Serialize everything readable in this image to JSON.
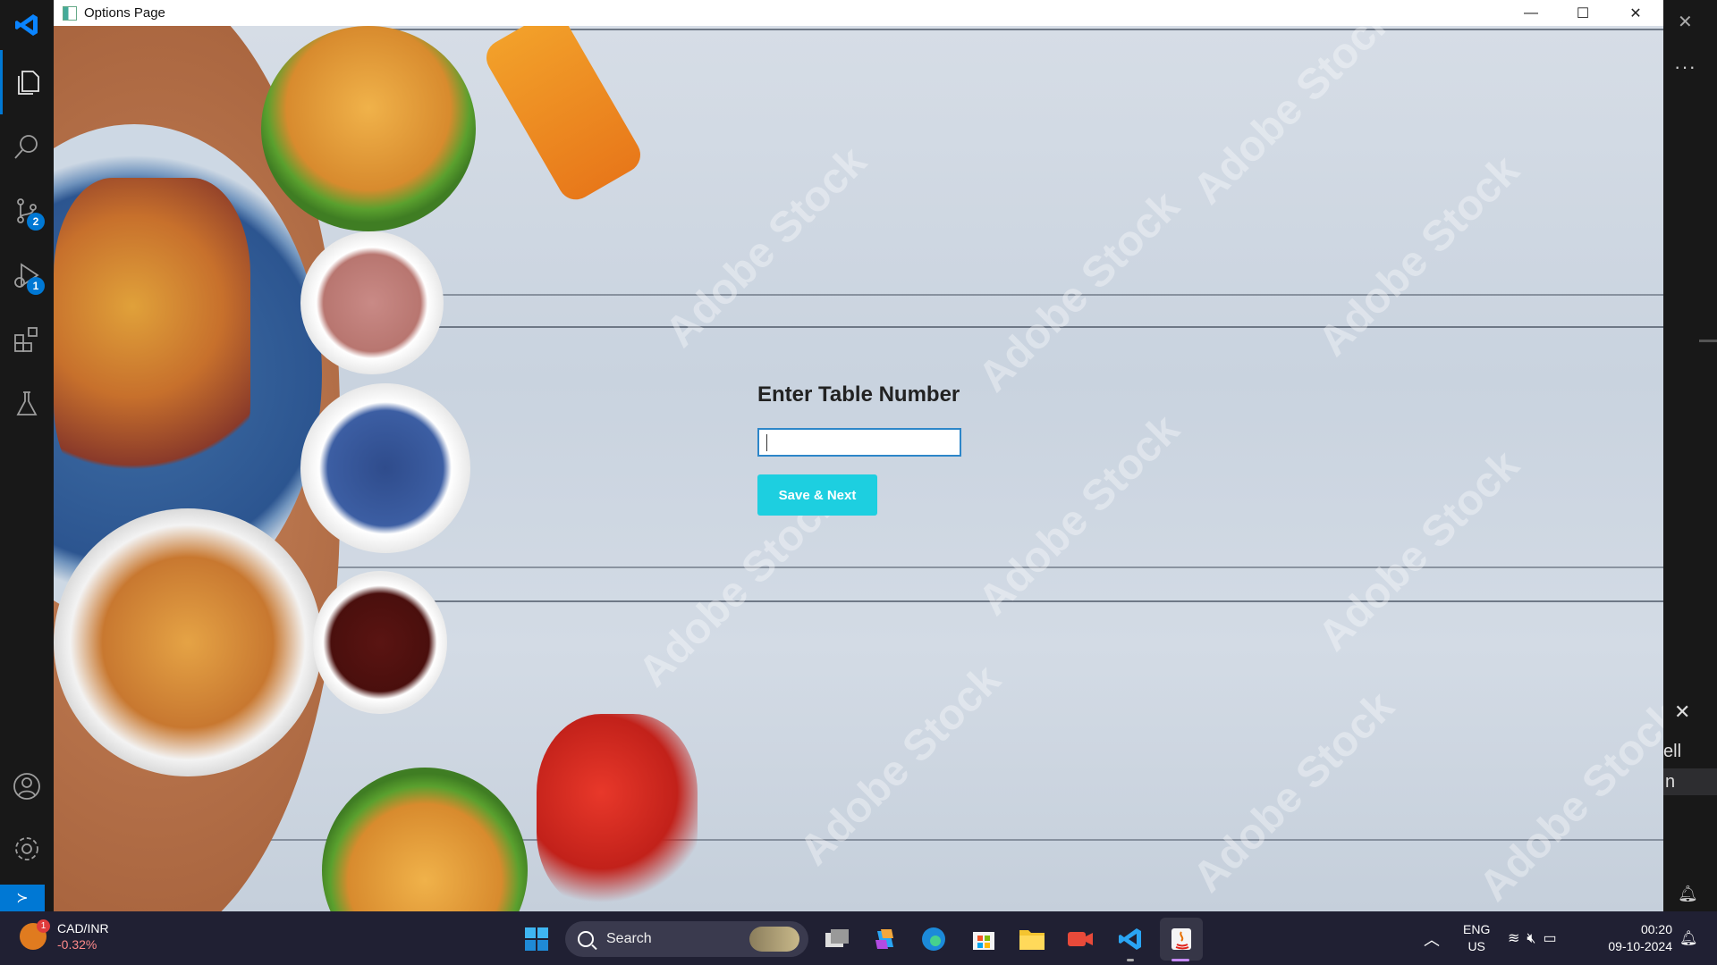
{
  "window": {
    "title": "Options Page",
    "minimize_glyph": "—",
    "maximize_glyph": "☐",
    "close_glyph": "✕"
  },
  "form": {
    "heading": "Enter Table Number",
    "input_value": "",
    "save_label": "Save & Next"
  },
  "background": {
    "watermark": "Adobe Stock"
  },
  "activity_bar": {
    "source_control_badge": "2",
    "run_debug_badge": "1",
    "icons": [
      "explorer-icon",
      "search-icon",
      "source-control-icon",
      "run-debug-icon",
      "extensions-icon",
      "testing-icon",
      "account-icon",
      "settings-icon"
    ]
  },
  "vscode_right": {
    "close_glyph": "✕",
    "more_glyph": "···",
    "panel_close_glyph": "✕",
    "panel_line_1": "ell",
    "panel_line_2": "n"
  },
  "taskbar": {
    "widget_badge": "1",
    "widget_title": "CAD/INR",
    "widget_value": "-0.32%",
    "search_label": "Search",
    "lang_line1": "ENG",
    "lang_line2": "US",
    "time": "00:20",
    "date": "09-10-2024"
  },
  "colors": {
    "accent_button": "#1dcfe0",
    "input_border": "#2d86c9",
    "vscode_blue": "#0078d4"
  }
}
